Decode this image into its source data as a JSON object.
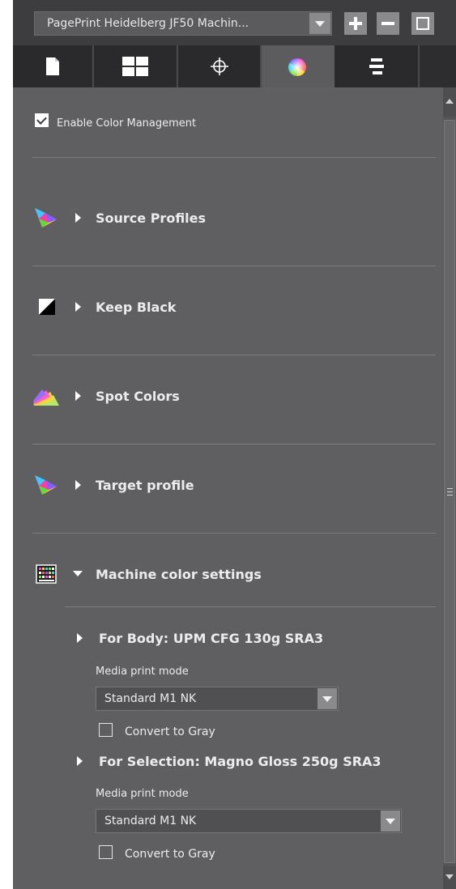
{
  "toolbar": {
    "preset_name": "PagePrint Heidelberg JF50 Machin...",
    "icons": [
      "chevron-down-icon",
      "plus-icon",
      "minus-icon",
      "maximize-icon"
    ]
  },
  "tabs": [
    {
      "icon": "document-icon",
      "selected": false
    },
    {
      "icon": "layout-grid-icon",
      "selected": false
    },
    {
      "icon": "crosshair-icon",
      "selected": false
    },
    {
      "icon": "color-wheel-icon",
      "selected": true
    },
    {
      "icon": "align-bars-icon",
      "selected": false
    }
  ],
  "panel": {
    "enable_cm_label": "Enable Color Management",
    "enable_cm_checked": true,
    "sections": [
      {
        "label": "Source Profiles",
        "icon": "color-triangle-icon",
        "expanded": false
      },
      {
        "label": "Keep Black",
        "icon": "black-white-square-icon",
        "expanded": false
      },
      {
        "label": "Spot Colors",
        "icon": "color-swatches-icon",
        "expanded": false
      },
      {
        "label": "Target profile",
        "icon": "color-triangle-icon",
        "expanded": false
      },
      {
        "label": "Machine color settings",
        "icon": "color-chart-icon",
        "expanded": true
      }
    ],
    "machine": {
      "body": {
        "title": "For Body: UPM CFG 130g SRA3",
        "media_label": "Media print mode",
        "mode_value": "Standard M1 NK",
        "gray_label": "Convert to Gray",
        "gray_checked": false
      },
      "selection": {
        "title": "For Selection: Magno Gloss 250g SRA3",
        "media_label": "Media print mode",
        "mode_value": "Standard M1 NK",
        "gray_label": "Convert to Gray",
        "gray_checked": false
      }
    }
  },
  "colors": {
    "panel_bg": "#5f5f62",
    "toolbar_bg": "#3d3d3f",
    "tab_selected_bg": "#5c5c5e",
    "text": "#ececec"
  }
}
